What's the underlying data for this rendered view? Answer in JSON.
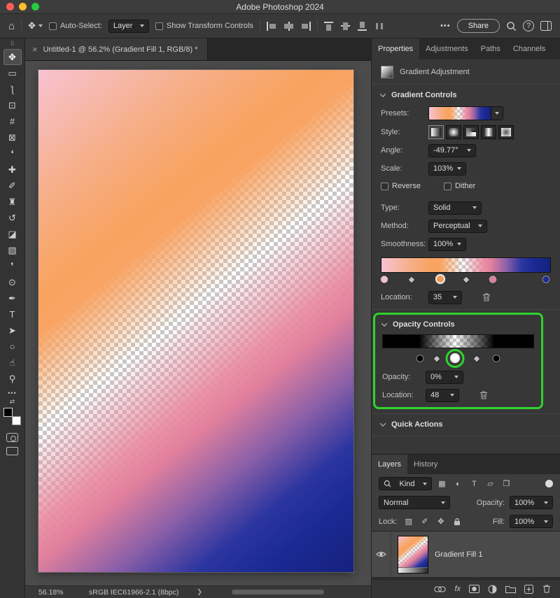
{
  "annotation": {
    "color": "#2ed32e"
  },
  "window": {
    "title": "Adobe Photoshop 2024"
  },
  "options_bar": {
    "auto_select_label": "Auto-Select:",
    "auto_select_value": "Layer",
    "show_transform_label": "Show Transform Controls",
    "share_label": "Share"
  },
  "document_tab": {
    "title": "Untitled-1 @ 56.2% (Gradient Fill 1, RGB/8) *"
  },
  "toolbar": {
    "tools": [
      {
        "name": "move",
        "glyph": "✥",
        "selected": true
      },
      {
        "name": "rectangular-marquee",
        "glyph": "▭"
      },
      {
        "name": "lasso",
        "glyph": "ƪ"
      },
      {
        "name": "object-selection",
        "glyph": "⊡"
      },
      {
        "name": "crop",
        "glyph": "#"
      },
      {
        "name": "frame",
        "glyph": "⊠"
      },
      {
        "name": "eyedropper",
        "glyph": "❛"
      },
      {
        "name": "healing-brush",
        "glyph": "✚"
      },
      {
        "name": "brush",
        "glyph": "✐"
      },
      {
        "name": "clone-stamp",
        "glyph": "♜"
      },
      {
        "name": "history-brush",
        "glyph": "↺"
      },
      {
        "name": "eraser",
        "glyph": "◪"
      },
      {
        "name": "gradient",
        "glyph": "▧"
      },
      {
        "name": "blur",
        "glyph": "❜"
      },
      {
        "name": "dodge",
        "glyph": "⊙"
      },
      {
        "name": "pen",
        "glyph": "✒"
      },
      {
        "name": "type",
        "glyph": "T"
      },
      {
        "name": "path-selection",
        "glyph": "➤"
      },
      {
        "name": "ellipse",
        "glyph": "○"
      },
      {
        "name": "hand",
        "glyph": "☝"
      },
      {
        "name": "zoom",
        "glyph": "⚲"
      }
    ]
  },
  "status_bar": {
    "zoom": "56.18%",
    "profile": "sRGB IEC61966-2.1 (8bpc)"
  },
  "properties": {
    "tabs": [
      "Properties",
      "Adjustments",
      "Paths",
      "Channels"
    ],
    "header_title": "Gradient Adjustment",
    "gradient_controls": {
      "title": "Gradient Controls",
      "presets_label": "Presets:",
      "style_label": "Style:",
      "angle_label": "Angle:",
      "angle_value": "-49.77°",
      "scale_label": "Scale:",
      "scale_value": "103%",
      "reverse_label": "Reverse",
      "dither_label": "Dither",
      "type_label": "Type:",
      "type_value": "Solid",
      "method_label": "Method:",
      "method_value": "Perceptual",
      "smoothness_label": "Smoothness:",
      "smoothness_value": "100%",
      "location_label": "Location:",
      "location_value": "35"
    },
    "opacity_controls": {
      "title": "Opacity Controls",
      "opacity_label": "Opacity:",
      "opacity_value": "0%",
      "location_label": "Location:",
      "location_value": "48"
    },
    "quick_actions_title": "Quick Actions"
  },
  "layers_panel": {
    "tabs": [
      "Layers",
      "History"
    ],
    "kind_label": "Kind",
    "blend_mode": "Normal",
    "opacity_label": "Opacity:",
    "opacity_value": "100%",
    "lock_label": "Lock:",
    "fill_label": "Fill:",
    "fill_value": "100%",
    "layer": {
      "name": "Gradient Fill 1"
    }
  },
  "gradient": {
    "photoshop_angle": "-49.77°",
    "canvas_css_angle": "141deg",
    "css_stops": [
      "#f7c3d2 0%",
      "#f6ae86 18%",
      "#f8a35f 30%",
      "#f9a464 35%",
      "rgba(249,170,120,0) 48%",
      "rgba(233,140,160,0.92) 60%",
      "#e2809d 65%",
      "#8c60a8 74%",
      "#2b35a0 83%",
      "#1a2a94 90%",
      "#16217c 100%"
    ],
    "opacity_css_stops": [
      "#000000 0%",
      "#000000 24%",
      "rgba(0,0,0,0) 48%",
      "#000000 74%",
      "#000000 100%"
    ],
    "color_stops": [
      {
        "name": "color-stop-light-pink",
        "color": "#f2bfd4",
        "pos": 2
      },
      {
        "name": "color-stop-orange",
        "color": "#f19a55",
        "pos": 35,
        "selected": true
      },
      {
        "name": "color-stop-pink",
        "color": "#dd7f9b",
        "pos": 66
      },
      {
        "name": "color-stop-navy",
        "color": "#1c2c96",
        "pos": 97
      }
    ],
    "color_midpoints": [
      18,
      50
    ],
    "opacity_stops": [
      {
        "name": "opacity-stop-left",
        "color": "#000000",
        "pos": 25
      },
      {
        "name": "opacity-stop-selected",
        "color": "#ffffff",
        "pos": 48,
        "selected": true,
        "annotated": true
      },
      {
        "name": "opacity-stop-right",
        "color": "#000000",
        "pos": 75
      }
    ],
    "opacity_midpoints": [
      36,
      62
    ]
  },
  "icons": {
    "home": "⌂",
    "more": "•••",
    "help": "?",
    "close_tab": "×",
    "status_chevron": "❯",
    "grip": "⠿",
    "fx": "fx",
    "swap_colors": "⇄",
    "kind_pixel": "▦",
    "kind_adjust": "◐",
    "kind_type": "T",
    "kind_shape": "▱",
    "kind_smart": "❐",
    "lock_transparent": "▨",
    "lock_pixels": "✐",
    "lock_position": "✥"
  }
}
